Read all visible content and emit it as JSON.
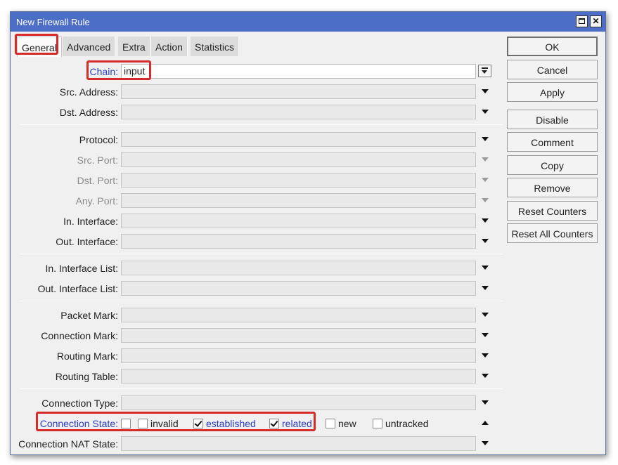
{
  "window": {
    "title": "New Firewall Rule"
  },
  "tabs": [
    "General",
    "Advanced",
    "Extra",
    "Action",
    "Statistics"
  ],
  "fields": {
    "chain": {
      "label": "Chain:",
      "value": "input"
    },
    "src_address": "Src. Address:",
    "dst_address": "Dst. Address:",
    "protocol": "Protocol:",
    "src_port": "Src. Port:",
    "dst_port": "Dst. Port:",
    "any_port": "Any. Port:",
    "in_interface": "In. Interface:",
    "out_interface": "Out. Interface:",
    "in_interface_list": "In. Interface List:",
    "out_interface_list": "Out. Interface List:",
    "packet_mark": "Packet Mark:",
    "connection_mark": "Connection Mark:",
    "routing_mark": "Routing Mark:",
    "routing_table": "Routing Table:",
    "connection_type": "Connection Type:",
    "connection_nat_state": "Connection NAT State:"
  },
  "connection_state": {
    "label": "Connection State:",
    "options": [
      {
        "label": "invalid",
        "checked": false
      },
      {
        "label": "established",
        "checked": true
      },
      {
        "label": "related",
        "checked": true
      },
      {
        "label": "new",
        "checked": false
      },
      {
        "label": "untracked",
        "checked": false
      }
    ]
  },
  "buttons": [
    "OK",
    "Cancel",
    "Apply",
    "Disable",
    "Comment",
    "Copy",
    "Remove",
    "Reset Counters",
    "Reset All Counters"
  ],
  "colors": {
    "titlebar": "#4c6ec6",
    "highlight": "#d52b2b",
    "link_blue": "#2a3fbf"
  }
}
